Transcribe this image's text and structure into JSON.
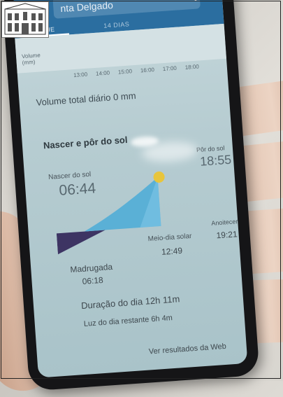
{
  "app_bar": {
    "location": "nta Delgado",
    "tabs": [
      "HOJE",
      "14 DIAS"
    ]
  },
  "precipitation": {
    "label": "Volume (mm)",
    "hours": [
      "13:00",
      "14:00",
      "15:00",
      "16:00",
      "17:00",
      "18:00"
    ],
    "daily_total": "Volume total diário 0 mm"
  },
  "sun": {
    "section_title": "Nascer e pôr do sol",
    "sunrise_label": "Nascer do sol",
    "sunrise_time": "06:44",
    "sunset_label": "Pôr do sol",
    "sunset_time": "18:55",
    "dawn_label": "Madrugada",
    "dawn_time": "06:18",
    "solar_noon_label": "Meio-dia solar",
    "solar_noon_time": "12:49",
    "dusk_label": "Anoitecer",
    "dusk_time": "19:21",
    "day_length": "Duração do dia 12h 11m",
    "daylight_left": "Luz do dia restante 6h 4m",
    "web_results": "Ver resultados da Web"
  },
  "colors": {
    "app_bar": "#2b6ea0",
    "night": "#3d3463",
    "day": "#5ab0d6",
    "sun": "#e8c53c"
  }
}
